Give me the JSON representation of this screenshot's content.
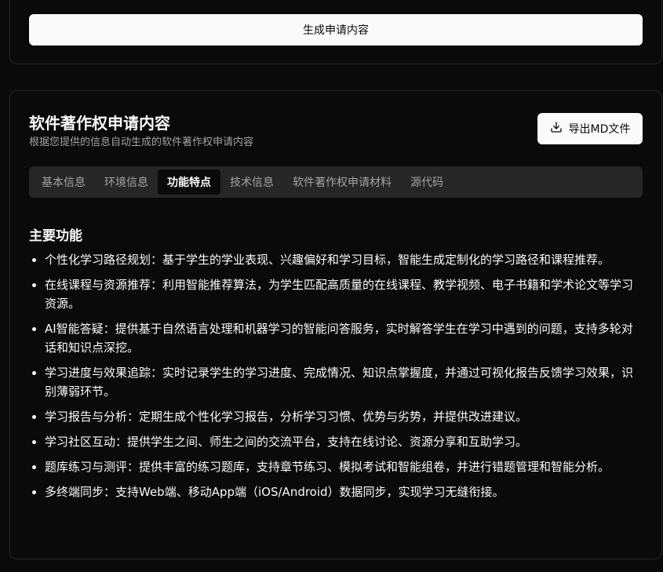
{
  "top_card": {
    "generate_button": "生成申请内容"
  },
  "result": {
    "title": "软件著作权申请内容",
    "subtitle": "根据您提供的信息自动生成的软件著作权申请内容",
    "export_button": "导出MD文件",
    "tabs": [
      {
        "label": "基本信息",
        "active": false
      },
      {
        "label": "环境信息",
        "active": false
      },
      {
        "label": "功能特点",
        "active": true
      },
      {
        "label": "技术信息",
        "active": false
      },
      {
        "label": "软件著作权申请材料",
        "active": false
      },
      {
        "label": "源代码",
        "active": false
      }
    ],
    "section_title": "主要功能",
    "features": [
      "个性化学习路径规划：基于学生的学业表现、兴趣偏好和学习目标，智能生成定制化的学习路径和课程推荐。",
      "在线课程与资源推荐：利用智能推荐算法，为学生匹配高质量的在线课程、教学视频、电子书籍和学术论文等学习资源。",
      "AI智能答疑：提供基于自然语言处理和机器学习的智能问答服务，实时解答学生在学习中遇到的问题，支持多轮对话和知识点深挖。",
      "学习进度与效果追踪：实时记录学生的学习进度、完成情况、知识点掌握度，并通过可视化报告反馈学习效果，识别薄弱环节。",
      "学习报告与分析：定期生成个性化学习报告，分析学习习惯、优势与劣势，并提供改进建议。",
      "学习社区互动：提供学生之间、师生之间的交流平台，支持在线讨论、资源分享和互助学习。",
      "题库练习与测评：提供丰富的练习题库，支持章节练习、模拟考试和智能组卷，并进行错题管理和智能分析。",
      "多终端同步：支持Web端、移动App端（iOS/Android）数据同步，实现学习无缝衔接。"
    ]
  }
}
